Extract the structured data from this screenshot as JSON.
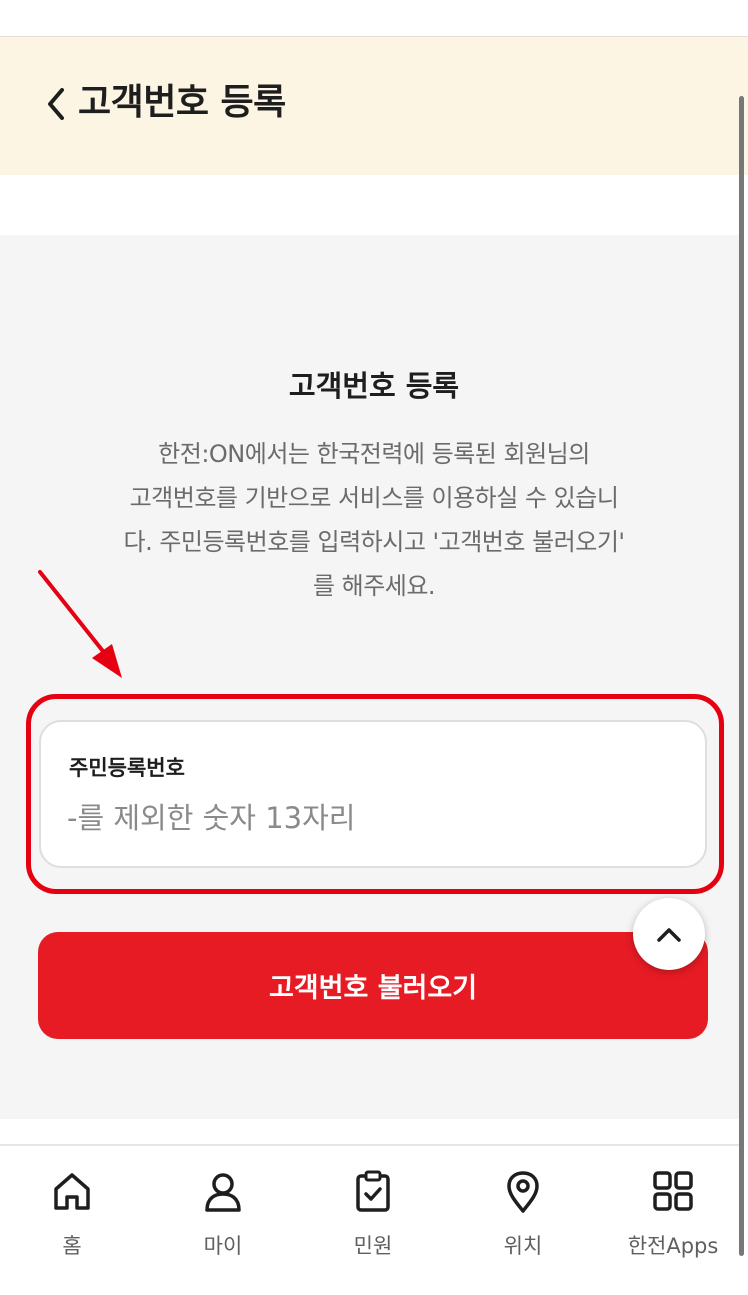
{
  "header": {
    "title": "고객번호 등록",
    "back_icon": "chevron-left-icon"
  },
  "main": {
    "section_title": "고객번호 등록",
    "description_lines": [
      "한전:ON에서는 한국전력에 등록된 회원님의",
      "고객번호를 기반으로 서비스를 이용하실 수 있습니",
      "다. 주민등록번호를 입력하시고 '고객번호 불러오기'",
      "를 해주세요."
    ],
    "id_field": {
      "label": "주민등록번호",
      "value": "",
      "placeholder": "-를 제외한 숫자 13자리"
    },
    "submit_label": "고객번호 불러오기",
    "scroll_top_icon": "chevron-up-icon"
  },
  "tabbar": {
    "items": [
      {
        "label": "홈",
        "icon": "home-icon"
      },
      {
        "label": "마이",
        "icon": "user-icon"
      },
      {
        "label": "민원",
        "icon": "clipboard-check-icon"
      },
      {
        "label": "위치",
        "icon": "map-pin-icon"
      },
      {
        "label": "한전Apps",
        "icon": "apps-grid-icon"
      }
    ]
  },
  "colors": {
    "header_bg": "#fdf5e4",
    "primary_red": "#e61b24",
    "highlight_red": "#e50012",
    "content_bg": "#f5f5f5"
  }
}
